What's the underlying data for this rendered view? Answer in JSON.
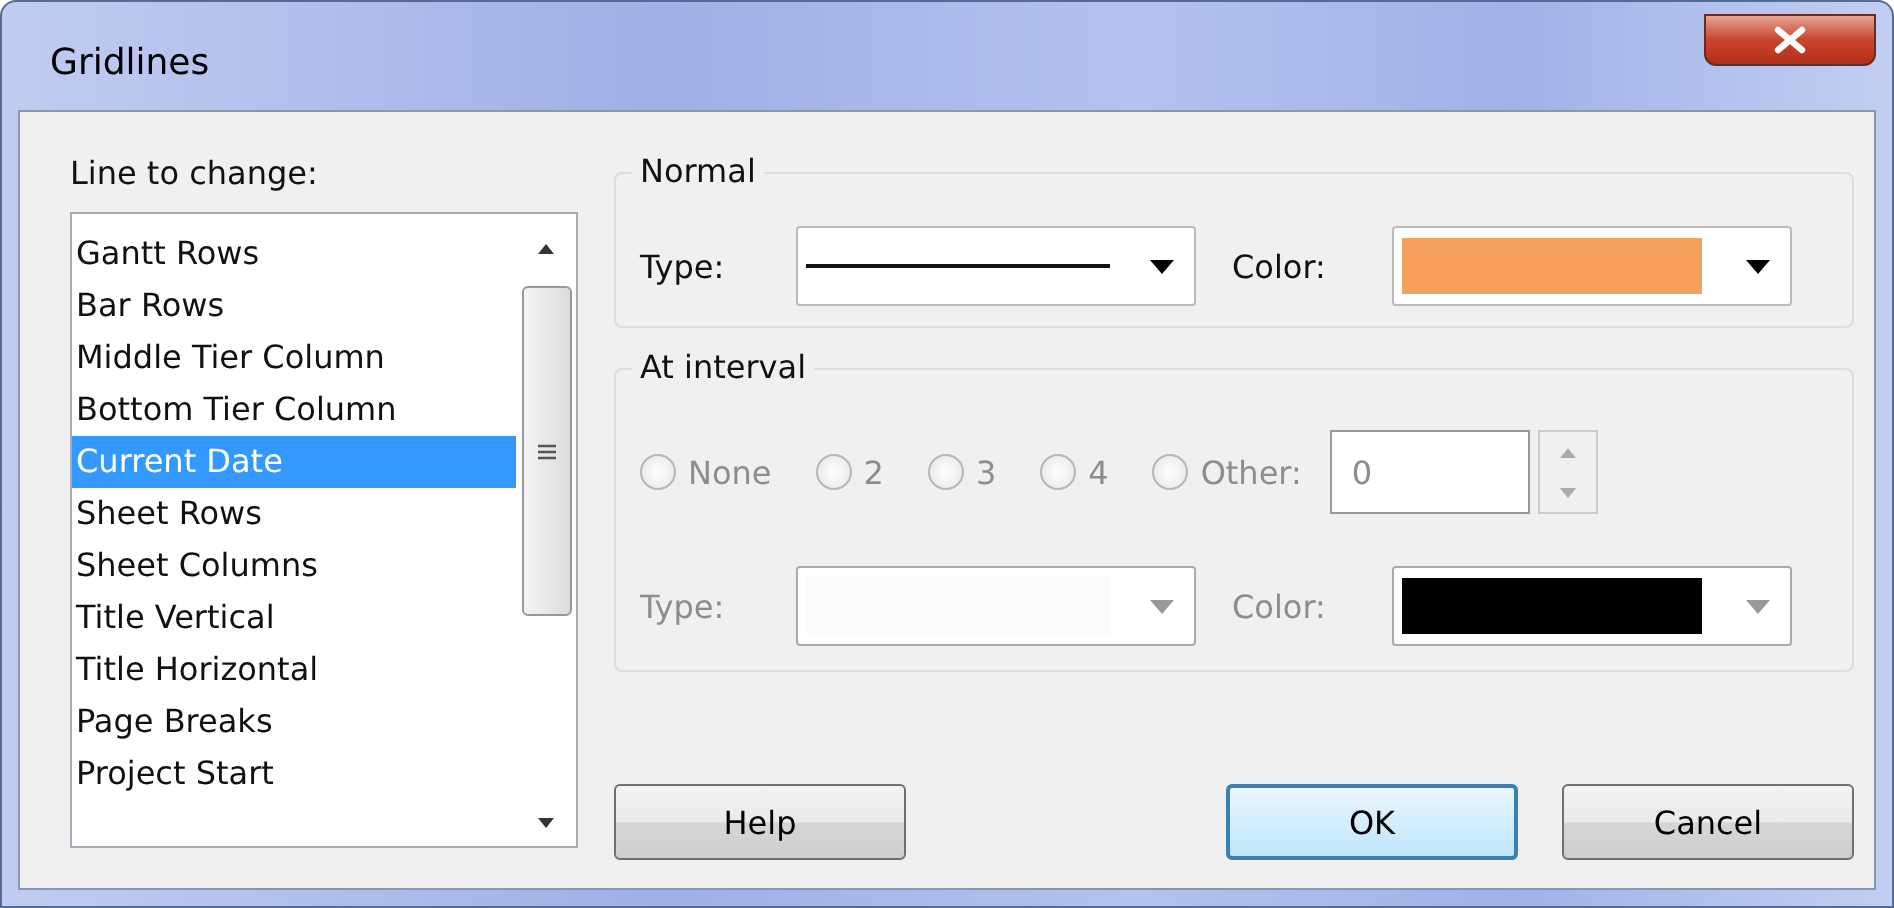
{
  "window": {
    "title": "Gridlines"
  },
  "line_list": {
    "label": "Line to change:",
    "items": [
      {
        "label": "Gantt Rows",
        "selected": false
      },
      {
        "label": "Bar Rows",
        "selected": false
      },
      {
        "label": "Middle Tier Column",
        "selected": false
      },
      {
        "label": "Bottom Tier Column",
        "selected": false
      },
      {
        "label": "Current Date",
        "selected": true
      },
      {
        "label": "Sheet Rows",
        "selected": false
      },
      {
        "label": "Sheet Columns",
        "selected": false
      },
      {
        "label": "Title Vertical",
        "selected": false
      },
      {
        "label": "Title Horizontal",
        "selected": false
      },
      {
        "label": "Page Breaks",
        "selected": false
      },
      {
        "label": "Project Start",
        "selected": false
      }
    ]
  },
  "normal": {
    "title": "Normal",
    "type_label": "Type:",
    "line_shown": true,
    "color_label": "Color:",
    "color": "#f4a05a"
  },
  "at_interval": {
    "title": "At interval",
    "disabled": true,
    "options": [
      {
        "label": "None",
        "selected": false
      },
      {
        "label": "2",
        "selected": false
      },
      {
        "label": "3",
        "selected": false
      },
      {
        "label": "4",
        "selected": false
      },
      {
        "label": "Other:",
        "selected": false
      }
    ],
    "other_value": "0",
    "type_label": "Type:",
    "line_shown": false,
    "color_label": "Color:",
    "color": "#000000"
  },
  "buttons": [
    {
      "label": "Help",
      "default": false
    },
    {
      "label": "OK",
      "default": true
    },
    {
      "label": "Cancel",
      "default": false
    }
  ]
}
